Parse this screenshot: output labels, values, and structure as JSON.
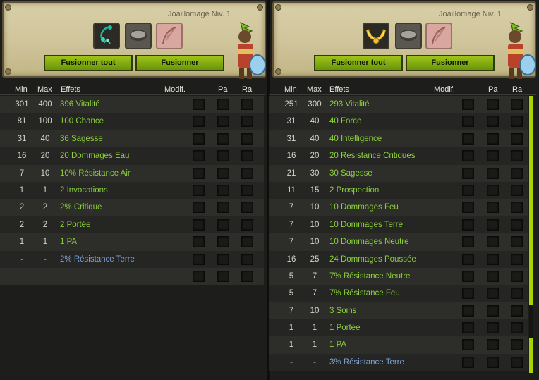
{
  "left_panel": {
    "job_title": "Joaillomage Niv. 1",
    "item_icon": "amulet-icon",
    "buttons": {
      "fuse_all": "Fusionner tout",
      "fuse": "Fusionner"
    },
    "headers": {
      "min": "Min",
      "max": "Max",
      "effects": "Effets",
      "modif": "Modif.",
      "pa": "Pa",
      "ra": "Ra"
    },
    "rows": [
      {
        "min": "301",
        "max": "400",
        "effect": "396 Vitalité",
        "kind": "positive"
      },
      {
        "min": "81",
        "max": "100",
        "effect": "100 Chance",
        "kind": "positive"
      },
      {
        "min": "31",
        "max": "40",
        "effect": "36 Sagesse",
        "kind": "positive"
      },
      {
        "min": "16",
        "max": "20",
        "effect": "20 Dommages Eau",
        "kind": "positive"
      },
      {
        "min": "7",
        "max": "10",
        "effect": "10% Résistance Air",
        "kind": "positive"
      },
      {
        "min": "1",
        "max": "1",
        "effect": "2 Invocations",
        "kind": "positive"
      },
      {
        "min": "2",
        "max": "2",
        "effect": "2% Critique",
        "kind": "positive"
      },
      {
        "min": "2",
        "max": "2",
        "effect": "2 Portée",
        "kind": "positive"
      },
      {
        "min": "1",
        "max": "1",
        "effect": "1 PA",
        "kind": "positive"
      },
      {
        "min": "-",
        "max": "-",
        "effect": "2% Résistance Terre",
        "kind": "neutral"
      },
      {
        "min": "",
        "max": "",
        "effect": "",
        "kind": "empty"
      }
    ]
  },
  "right_panel": {
    "job_title": "Joaillomage Niv. 1",
    "item_icon": "golden-amulet-icon",
    "buttons": {
      "fuse_all": "Fusionner tout",
      "fuse": "Fusionner"
    },
    "headers": {
      "min": "Min",
      "max": "Max",
      "effects": "Effets",
      "modif": "Modif.",
      "pa": "Pa",
      "ra": "Ra"
    },
    "rows": [
      {
        "min": "251",
        "max": "300",
        "effect": "293 Vitalité",
        "kind": "positive"
      },
      {
        "min": "31",
        "max": "40",
        "effect": "40 Force",
        "kind": "positive"
      },
      {
        "min": "31",
        "max": "40",
        "effect": "40 Intelligence",
        "kind": "positive"
      },
      {
        "min": "16",
        "max": "20",
        "effect": "20 Résistance Critiques",
        "kind": "positive"
      },
      {
        "min": "21",
        "max": "30",
        "effect": "30 Sagesse",
        "kind": "positive"
      },
      {
        "min": "11",
        "max": "15",
        "effect": "2 Prospection",
        "kind": "positive"
      },
      {
        "min": "7",
        "max": "10",
        "effect": "10 Dommages Feu",
        "kind": "positive"
      },
      {
        "min": "7",
        "max": "10",
        "effect": "10 Dommages Terre",
        "kind": "positive"
      },
      {
        "min": "7",
        "max": "10",
        "effect": "10 Dommages Neutre",
        "kind": "positive"
      },
      {
        "min": "16",
        "max": "25",
        "effect": "24 Dommages Poussée",
        "kind": "positive"
      },
      {
        "min": "5",
        "max": "7",
        "effect": "7% Résistance Neutre",
        "kind": "positive"
      },
      {
        "min": "5",
        "max": "7",
        "effect": "7% Résistance Feu",
        "kind": "positive"
      },
      {
        "min": "7",
        "max": "10",
        "effect": "3 Soins",
        "kind": "positive"
      },
      {
        "min": "1",
        "max": "1",
        "effect": "1 Portée",
        "kind": "positive"
      },
      {
        "min": "1",
        "max": "1",
        "effect": "1 PA",
        "kind": "positive"
      },
      {
        "min": "-",
        "max": "-",
        "effect": "3% Résistance Terre",
        "kind": "neutral"
      }
    ]
  },
  "colors": {
    "positive_effect": "#8bd13a",
    "neutral_effect": "#7fa2d6",
    "button": "#8cb414",
    "scrollbar": "#a6d400"
  }
}
